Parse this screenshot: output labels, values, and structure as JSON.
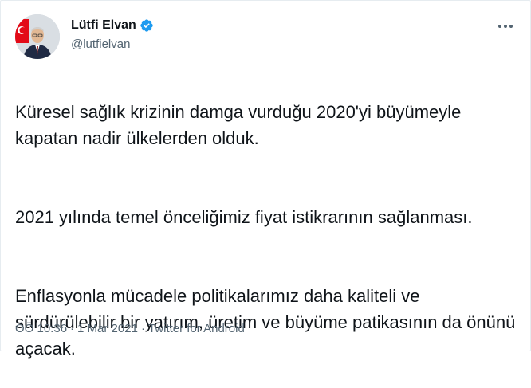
{
  "tweet": {
    "author": {
      "name": "Lütfi Elvan",
      "handle": "@lutfielvan",
      "verified": true
    },
    "paragraphs": [
      "Küresel sağlık krizinin damga vurduğu 2020'yi büyümeyle kapatan nadir ülkelerden olduk.",
      "2021 yılında temel önceliğimiz fiyat istikrarının sağlanması.",
      "Enflasyonla mücadele politikalarımız daha kaliteli ve sürdürülebilir bir yatırım, üretim ve büyüme patikasının da önünü açacak."
    ],
    "time": "ÖÖ 10:36",
    "separator": "·",
    "date": "1 Mar 2021",
    "source": "Twitter for Android"
  },
  "icons": {
    "verified": "verified-badge-icon",
    "more": "more-dots-icon"
  },
  "colors": {
    "verified_blue": "#1d9bf0",
    "secondary_text": "#536471",
    "primary_text": "#0f1419",
    "flag_red": "#e30a17"
  }
}
